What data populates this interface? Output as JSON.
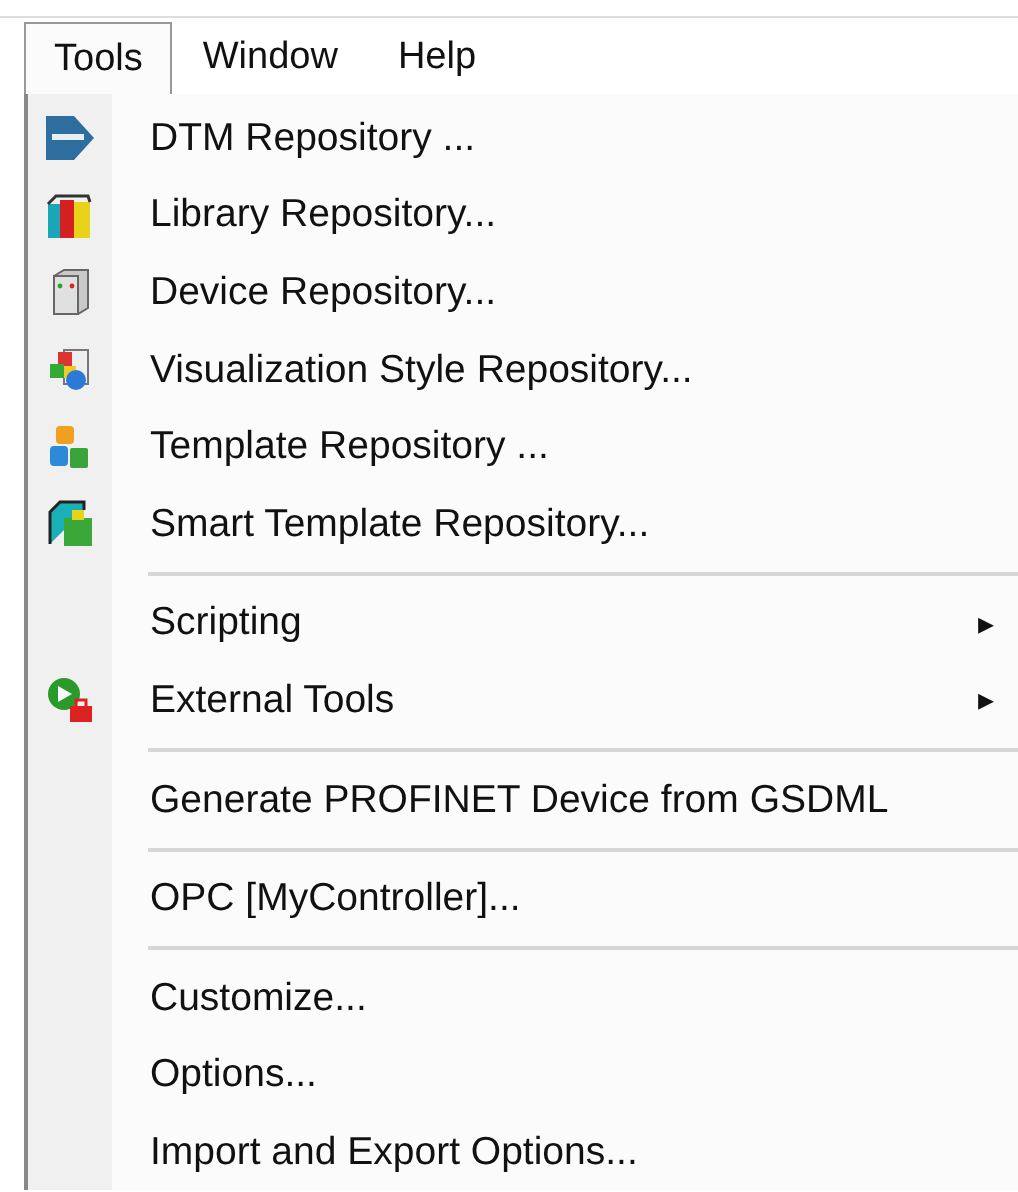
{
  "menubar": [
    {
      "label": "Tools",
      "selected": true
    },
    {
      "label": "Window",
      "selected": false
    },
    {
      "label": "Help",
      "selected": false
    }
  ],
  "menu": [
    {
      "kind": "item",
      "label": "DTM Repository ..."
    },
    {
      "kind": "item",
      "label": "Library Repository..."
    },
    {
      "kind": "item",
      "label": "Device Repository..."
    },
    {
      "kind": "item",
      "label": "Visualization Style Repository..."
    },
    {
      "kind": "item",
      "label": "Template Repository ..."
    },
    {
      "kind": "item",
      "label": "Smart Template Repository..."
    },
    {
      "kind": "separator"
    },
    {
      "kind": "item",
      "label": "Scripting",
      "arrow": "▸"
    },
    {
      "kind": "item",
      "label": "External Tools",
      "arrow": "▸"
    },
    {
      "kind": "separator"
    },
    {
      "kind": "item",
      "label": "Generate PROFINET Device from GSDML"
    },
    {
      "kind": "separator"
    },
    {
      "kind": "item",
      "label": "OPC [MyController]..."
    },
    {
      "kind": "separator"
    },
    {
      "kind": "item",
      "label": "Customize..."
    },
    {
      "kind": "item",
      "label": "Options..."
    },
    {
      "kind": "item",
      "label": "Import and Export Options..."
    }
  ]
}
